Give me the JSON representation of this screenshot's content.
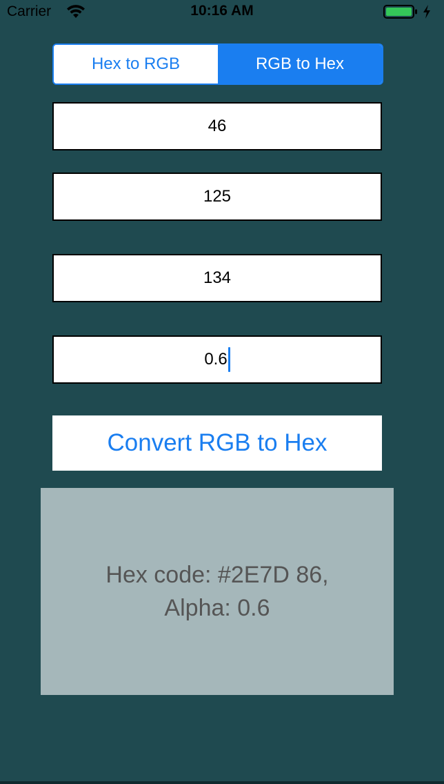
{
  "status_bar": {
    "carrier": "Carrier",
    "time": "10:16 AM",
    "battery_color": "#34c759"
  },
  "segmented": {
    "items": [
      {
        "label": "Hex to RGB",
        "selected": false
      },
      {
        "label": "RGB to Hex",
        "selected": true
      }
    ]
  },
  "inputs": {
    "red": "46",
    "green": "125",
    "blue": "134",
    "alpha": "0.6"
  },
  "convert_button": {
    "label": "Convert RGB to Hex"
  },
  "result": {
    "line1": "Hex code: #2E7D 86,",
    "line2": "Alpha: 0.6"
  },
  "colors": {
    "background": "#1f4a50",
    "accent": "#1a7ef0",
    "result_panel": "#a5b7ba",
    "result_text": "#555555"
  }
}
